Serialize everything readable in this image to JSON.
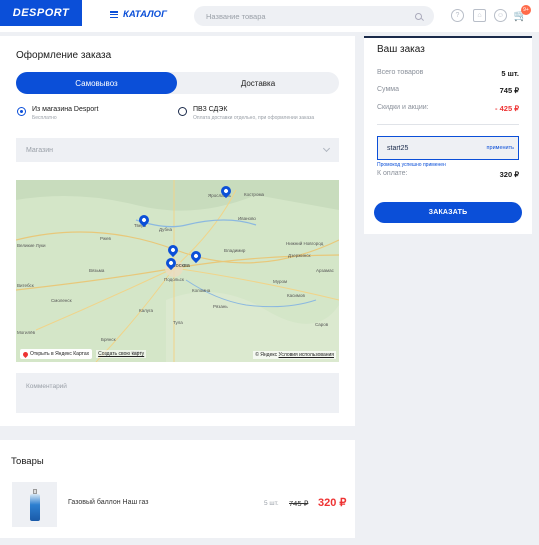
{
  "header": {
    "logo": "DESPORT",
    "catalog_label": "КАТАЛОГ",
    "search_placeholder": "Название товара",
    "cart_badge": "9+"
  },
  "order": {
    "title": "Оформление заказа",
    "tabs": [
      {
        "label": "Самовывоз",
        "active": true
      },
      {
        "label": "Доставка",
        "active": false
      }
    ],
    "options": [
      {
        "title": "Из магазина Desport",
        "subtitle": "Бесплатно",
        "selected": true
      },
      {
        "title": "ПВЗ СДЭК",
        "subtitle": "Оплата доставки отдельно, при оформлении заказа",
        "selected": false
      }
    ],
    "shop_select_placeholder": "Магазин",
    "map": {
      "open_in_yandex": "Открыть в Яндекс Картах",
      "create_map": "Создать свою карту",
      "copyright": "© Яндекс",
      "terms": "Условия использования",
      "cities": [
        "Ярославль",
        "Кострома",
        "Тверь",
        "Дубна",
        "Иваново",
        "Владимир",
        "Нижний Новгород",
        "Дзержинск",
        "Москва",
        "Подольск",
        "Коломна",
        "Рязань",
        "Калуга",
        "Тула",
        "Смоленск",
        "Вязьма",
        "Ржев",
        "Великие Луки",
        "Витебск",
        "Могилёв",
        "Брянск",
        "Орёл",
        "Муром",
        "Касимов",
        "Саров",
        "Арзамас"
      ]
    },
    "comment_placeholder": "Комментарий"
  },
  "summary": {
    "title": "Ваш заказ",
    "rows": [
      {
        "label": "Всего товаров",
        "value": "5 шт."
      },
      {
        "label": "Сумма",
        "value": "745 ₽"
      },
      {
        "label": "Скидки и акции:",
        "value": "- 425 ₽"
      }
    ],
    "promo_code": "start25",
    "promo_apply": "применить",
    "promo_success": "Промокод успешно применен",
    "total_label": "К оплате:",
    "total_value": "320 ₽",
    "order_button": "ЗАКАЗАТЬ"
  },
  "products": {
    "title": "Товары",
    "items": [
      {
        "name": "Газовый баллон Наш газ",
        "qty": "5 шт.",
        "old_price": "745 ₽",
        "price": "320 ₽"
      }
    ]
  },
  "colors": {
    "accent": "#0b4fd8",
    "discount": "#e33333",
    "background": "#eef0f4"
  }
}
